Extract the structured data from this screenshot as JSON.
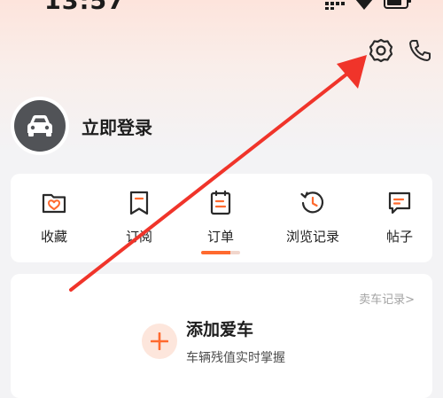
{
  "status_bar": {
    "time": "13:57",
    "icons": [
      "signal-icon",
      "wifi-icon",
      "battery-icon"
    ]
  },
  "header": {
    "actions": [
      "settings-icon",
      "phone-icon"
    ]
  },
  "profile": {
    "avatar_icon": "car-avatar-icon",
    "login_label": "立即登录"
  },
  "menu": {
    "items": [
      {
        "label": "收藏",
        "icon": "favorites-folder-icon"
      },
      {
        "label": "订阅",
        "icon": "bookmark-icon"
      },
      {
        "label": "订单",
        "icon": "clipboard-icon"
      },
      {
        "label": "浏览记录",
        "icon": "history-clock-icon"
      },
      {
        "label": "帖子",
        "icon": "message-icon"
      }
    ],
    "active_index": 2
  },
  "car_card": {
    "sell_record_link": "卖车记录>",
    "add_title": "添加爱车",
    "add_subtitle": "车辆残值实时掌握"
  },
  "colors": {
    "accent": "#ff6a2f",
    "arrow": "#f0342a",
    "avatar_bg": "#515357"
  }
}
